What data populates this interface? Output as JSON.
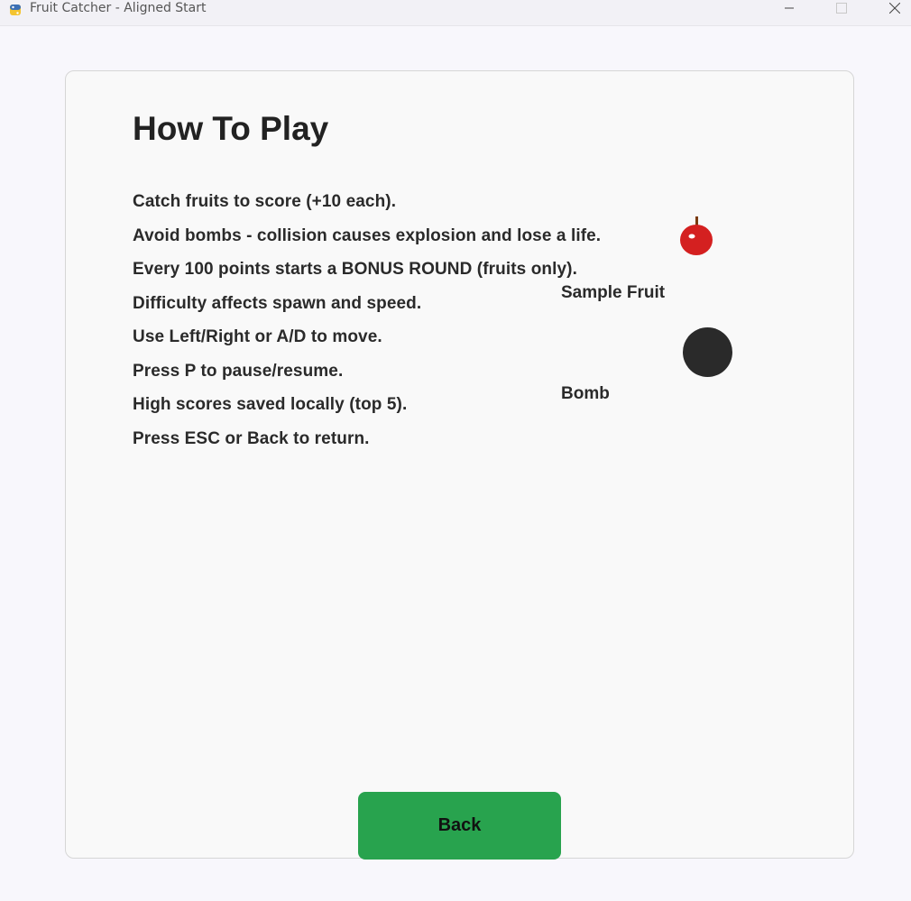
{
  "window": {
    "title": "Fruit Catcher - Aligned Start"
  },
  "screen": {
    "heading": "How To Play",
    "rules": [
      "Catch fruits to score (+10 each).",
      "Avoid bombs - collision causes explosion and lose a life.",
      "Every 100 points starts a BONUS ROUND (fruits only).",
      "Difficulty affects spawn and speed.",
      "Use Left/Right or A/D to move.",
      "Press P to pause/resume.",
      "High scores saved locally (top 5).",
      "Press ESC or Back to return."
    ],
    "samples": {
      "fruit_label": "Sample Fruit",
      "bomb_label": "Bomb"
    },
    "back_label": "Back"
  },
  "colors": {
    "fruit": "#d42020",
    "stem": "#7a3b10",
    "bomb": "#2a2a2a",
    "back_button": "#28a34e"
  },
  "icons": {
    "app": "python-snake-icon",
    "fruit": "apple-icon",
    "bomb": "bomb-icon"
  }
}
